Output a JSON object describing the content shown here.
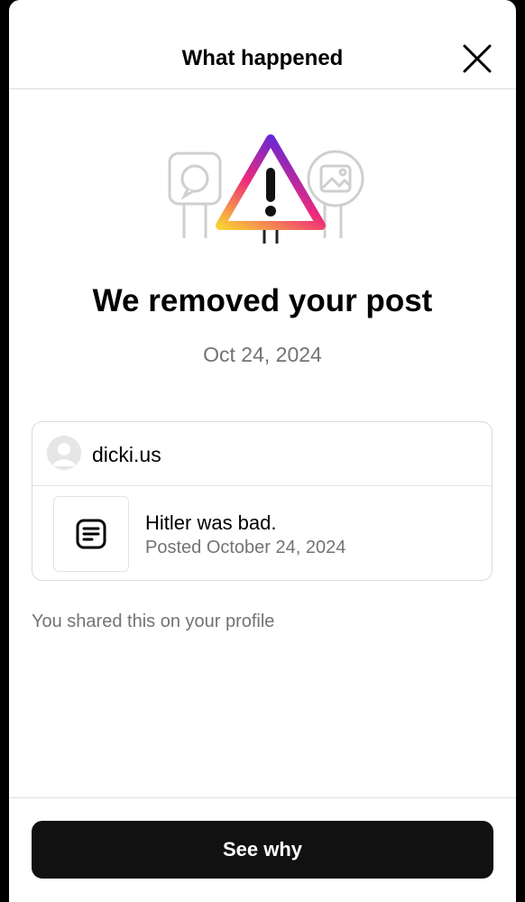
{
  "header": {
    "title": "What happened",
    "close_icon": "close-icon"
  },
  "hero": {
    "icon": "warning-triangle-icon",
    "accent_gradient": [
      "#f9ce34",
      "#ee2a7b",
      "#6228d7"
    ]
  },
  "main": {
    "headline": "We removed your post",
    "date": "Oct 24, 2024"
  },
  "post": {
    "username": "dicki.us",
    "avatar_icon": "avatar",
    "thumbnail_icon": "text-post-icon",
    "text": "Hitler was bad.",
    "meta": "Posted October 24, 2024"
  },
  "note": "You shared this on your profile",
  "footer": {
    "button_label": "See why"
  }
}
